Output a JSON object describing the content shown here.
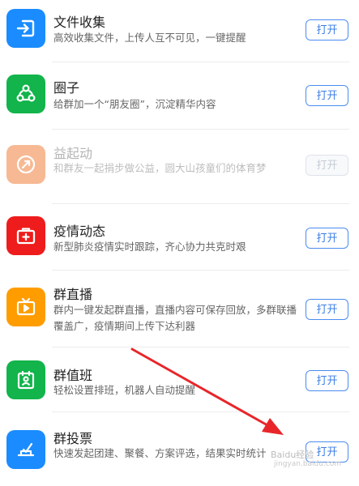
{
  "apps": [
    {
      "title": "文件收集",
      "desc": "高效收集文件，上传人互不可见，一键提醒",
      "button": "打开",
      "icon": "file-import-icon",
      "color": "#1a8cff",
      "enabled": true
    },
    {
      "title": "圈子",
      "desc": "给群加一个“朋友圈”，沉淀精华内容",
      "button": "打开",
      "icon": "circle-nodes-icon",
      "color": "#12b44b",
      "enabled": true
    },
    {
      "title": "益起动",
      "desc": "和群友一起捐步做公益，圆大山孩童们的体育梦",
      "button": "打开",
      "icon": "charity-run-icon",
      "color": "#f7b993",
      "enabled": false
    },
    {
      "title": "疫情动态",
      "desc": "新型肺炎疫情实时跟踪，齐心协力共克时艰",
      "button": "打开",
      "icon": "medical-kit-icon",
      "color": "#ee1c1c",
      "enabled": true
    },
    {
      "title": "群直播",
      "desc": "群内一键发起群直播，直播内容可保存回放，多群联播覆盖广，疫情期间上传下达利器",
      "button": "打开",
      "icon": "live-tv-icon",
      "color": "#ff9d00",
      "enabled": true
    },
    {
      "title": "群值班",
      "desc": "轻松设置排班，机器人自动提醒",
      "button": "打开",
      "icon": "duty-calendar-icon",
      "color": "#12b44b",
      "enabled": true
    },
    {
      "title": "群投票",
      "desc": "快速发起团建、聚餐、方案评选，结果实时统计",
      "button": "打开",
      "icon": "vote-box-icon",
      "color": "#1a8cff",
      "enabled": true
    }
  ],
  "watermark": {
    "main": "Baidu经验",
    "sub": "jingyan.baidu.com"
  },
  "colors": {
    "button_border": "#4a8cf0",
    "button_text": "#3d7fe6",
    "annotation_arrow": "#e8262a"
  }
}
